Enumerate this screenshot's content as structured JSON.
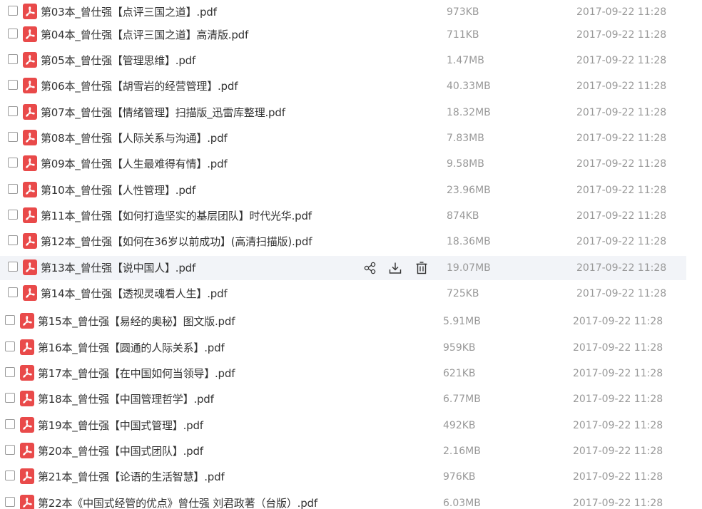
{
  "files": [
    {
      "name": "第03本_曾仕强【点评三国之道】.pdf",
      "size": "973KB",
      "date": "2017-09-22 11:28"
    },
    {
      "name": "第04本_曾仕强【点评三国之道】高清版.pdf",
      "size": "711KB",
      "date": "2017-09-22 11:28"
    },
    {
      "name": "第05本_曾仕强【管理思维】.pdf",
      "size": "1.47MB",
      "date": "2017-09-22 11:28"
    },
    {
      "name": "第06本_曾仕强【胡雪岩的经营管理】.pdf",
      "size": "40.33MB",
      "date": "2017-09-22 11:28"
    },
    {
      "name": "第07本_曾仕强【情绪管理】扫描版_迅雷库整理.pdf",
      "size": "18.32MB",
      "date": "2017-09-22 11:28"
    },
    {
      "name": "第08本_曾仕强【人际关系与沟通】.pdf",
      "size": "7.83MB",
      "date": "2017-09-22 11:28"
    },
    {
      "name": "第09本_曾仕强【人生最难得有情】.pdf",
      "size": "9.58MB",
      "date": "2017-09-22 11:28"
    },
    {
      "name": "第10本_曾仕强【人性管理】.pdf",
      "size": "23.96MB",
      "date": "2017-09-22 11:28"
    },
    {
      "name": "第11本_曾仕强【如何打造坚实的基层团队】时代光华.pdf",
      "size": "874KB",
      "date": "2017-09-22 11:28"
    },
    {
      "name": "第12本_曾仕强【如何在36岁以前成功】(高清扫描版).pdf",
      "size": "18.36MB",
      "date": "2017-09-22 11:28"
    },
    {
      "name": "第13本_曾仕强【说中国人】.pdf",
      "size": "19.07MB",
      "date": "2017-09-22 11:28"
    },
    {
      "name": "第14本_曾仕强【透视灵魂看人生】.pdf",
      "size": "725KB",
      "date": "2017-09-22 11:28"
    },
    {
      "name": "第15本_曾仕强【易经的奥秘】图文版.pdf",
      "size": "5.91MB",
      "date": "2017-09-22 11:28"
    },
    {
      "name": "第16本_曾仕强【圆通的人际关系】.pdf",
      "size": "959KB",
      "date": "2017-09-22 11:28"
    },
    {
      "name": "第17本_曾仕强【在中国如何当领导】.pdf",
      "size": "621KB",
      "date": "2017-09-22 11:28"
    },
    {
      "name": "第18本_曾仕强【中国管理哲学】.pdf",
      "size": "6.77MB",
      "date": "2017-09-22 11:28"
    },
    {
      "name": "第19本_曾仕强【中国式管理】.pdf",
      "size": "492KB",
      "date": "2017-09-22 11:28"
    },
    {
      "name": "第20本_曾仕强【中国式团队】.pdf",
      "size": "2.16MB",
      "date": "2017-09-22 11:28"
    },
    {
      "name": "第21本_曾仕强【论语的生活智慧】.pdf",
      "size": "976KB",
      "date": "2017-09-22 11:28"
    },
    {
      "name": "第22本《中国式经管的优点》曾仕强 刘君政著（台版）.pdf",
      "size": "6.03MB",
      "date": "2017-09-22 11:28"
    }
  ],
  "hovered_row_index": 10,
  "row_actions": [
    {
      "icon": "share-icon"
    },
    {
      "icon": "download-icon"
    },
    {
      "icon": "delete-icon"
    }
  ],
  "colors": {
    "pdf_icon": "#e94a4a",
    "hover_row": "#f2f4f8",
    "meta_text": "#999999",
    "name_text": "#333333"
  }
}
